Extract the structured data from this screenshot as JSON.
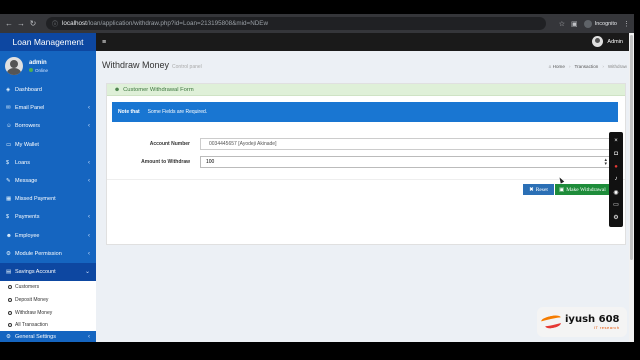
{
  "browser": {
    "url_host": "localhost",
    "url_path": "/loan/application/withdraw.php?id=Loan=213195808&mid=NDEw",
    "incognito_label": "Incognito"
  },
  "sidebar": {
    "brand": "Loan Management",
    "user_name": "admin",
    "user_status": "Online",
    "items": [
      {
        "label": "Dashboard",
        "icon": "dashboard-icon"
      },
      {
        "label": "Email Panel",
        "icon": "envelope-icon"
      },
      {
        "label": "Borrowers",
        "icon": "users-icon"
      },
      {
        "label": "My Wallet",
        "icon": "wallet-icon"
      },
      {
        "label": "Loans",
        "icon": "dollar-icon"
      },
      {
        "label": "Message",
        "icon": "message-icon"
      },
      {
        "label": "Missed Payment",
        "icon": "calendar-icon"
      },
      {
        "label": "Payments",
        "icon": "dollar-icon"
      },
      {
        "label": "Employee",
        "icon": "user-icon"
      },
      {
        "label": "Module Permission",
        "icon": "gear-icon"
      },
      {
        "label": "Savings Account",
        "icon": "bank-icon"
      }
    ],
    "subitems": [
      "Customers",
      "Deposit Money",
      "Withdraw Money",
      "All Transaction"
    ],
    "last_item": "General Settings"
  },
  "topbar": {
    "user": "Admin"
  },
  "header": {
    "title": "Withdraw Money",
    "subtitle": "Control panel",
    "breadcrumb": [
      "Home",
      "Transaction",
      "Withdraw"
    ]
  },
  "form": {
    "box_title": "Customer Withdrawal Form",
    "alert_bold": "Note that",
    "alert_text": "Some Fields are Required.",
    "account_label": "Account Number",
    "account_value": "0034445657 [Ayodeji Akinade]",
    "amount_label": "Amount to Withdraw",
    "amount_value": "100",
    "reset_label": "Reset",
    "submit_label": "Make Withdrawal"
  },
  "watermark": {
    "title": "iyush 608",
    "subtitle": "IT research"
  },
  "colors": {
    "sidebar": "#1565c0",
    "alert": "#1976d2",
    "success": "#1e8c3a",
    "header_bg": "#dff0d8"
  }
}
